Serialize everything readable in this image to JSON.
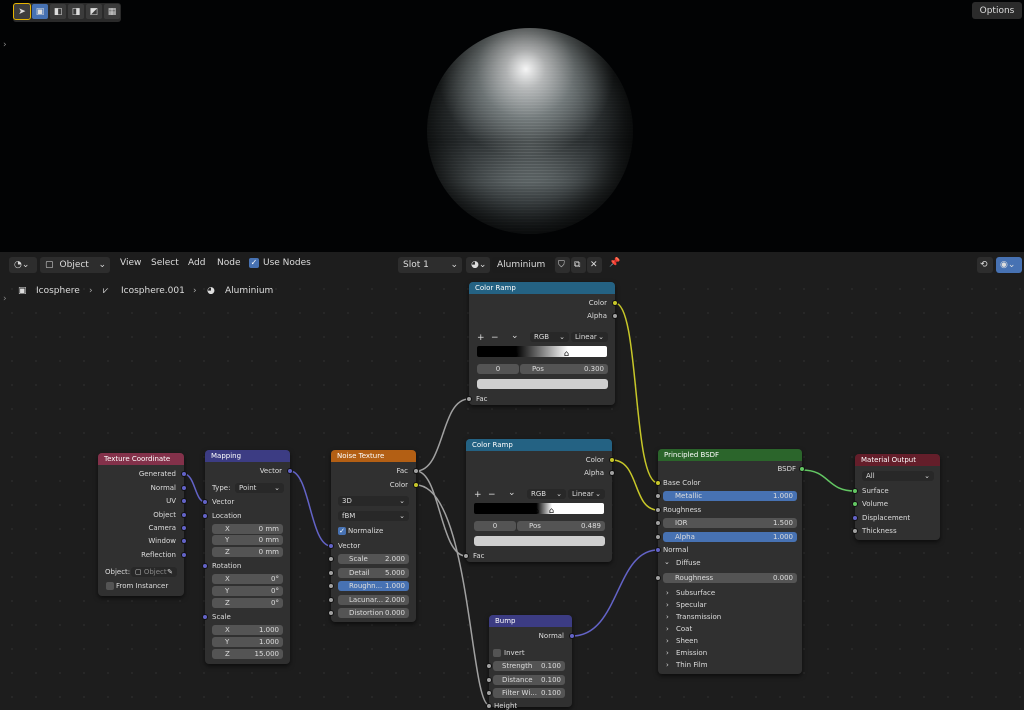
{
  "viewport": {
    "options_label": "Options"
  },
  "editor_header": {
    "object_mode": "Object",
    "menus": [
      "View",
      "Select",
      "Add",
      "Node"
    ],
    "use_nodes_label": "Use Nodes",
    "slot": "Slot 1",
    "material_name": "Aluminium"
  },
  "breadcrumb": [
    "Icosphere",
    "Icosphere.001",
    "Aluminium"
  ],
  "nodes": {
    "texcoord": {
      "title": "Texture Coordinate",
      "outputs": [
        "Generated",
        "Normal",
        "UV",
        "Object",
        "Camera",
        "Window",
        "Reflection"
      ],
      "object_label": "Object:",
      "object_placeholder": "Object",
      "from_instancer": "From Instancer"
    },
    "mapping": {
      "title": "Mapping",
      "output": "Vector",
      "type_label": "Type:",
      "type_value": "Point",
      "vector_label": "Vector",
      "location_label": "Location",
      "location": [
        {
          "k": "X",
          "v": "0 mm"
        },
        {
          "k": "Y",
          "v": "0 mm"
        },
        {
          "k": "Z",
          "v": "0 mm"
        }
      ],
      "rotation_label": "Rotation",
      "rotation": [
        {
          "k": "X",
          "v": "0°"
        },
        {
          "k": "Y",
          "v": "0°"
        },
        {
          "k": "Z",
          "v": "0°"
        }
      ],
      "scale_label": "Scale",
      "scale": [
        {
          "k": "X",
          "v": "1.000"
        },
        {
          "k": "Y",
          "v": "1.000"
        },
        {
          "k": "Z",
          "v": "15.000"
        }
      ]
    },
    "noise": {
      "title": "Noise Texture",
      "out_fac": "Fac",
      "out_color": "Color",
      "dimensions": "3D",
      "type": "fBM",
      "normalize": "Normalize",
      "vector_label": "Vector",
      "params": [
        {
          "k": "Scale",
          "v": "2.000"
        },
        {
          "k": "Detail",
          "v": "5.000"
        },
        {
          "k": "Roughn...",
          "v": "1.000"
        },
        {
          "k": "Lacunar...",
          "v": "2.000"
        },
        {
          "k": "Distortion",
          "v": "0.000"
        }
      ]
    },
    "ramp1": {
      "title": "Color Ramp",
      "out_color": "Color",
      "out_alpha": "Alpha",
      "mode": "RGB",
      "interp": "Linear",
      "index": "0",
      "pos_label": "Pos",
      "pos_value": "0.300",
      "in_fac": "Fac",
      "plus": "+",
      "minus": "−",
      "chevron": "⌄"
    },
    "ramp2": {
      "title": "Color Ramp",
      "out_color": "Color",
      "out_alpha": "Alpha",
      "mode": "RGB",
      "interp": "Linear",
      "index": "0",
      "pos_label": "Pos",
      "pos_value": "0.489",
      "in_fac": "Fac",
      "plus": "+",
      "minus": "−",
      "chevron": "⌄"
    },
    "bump": {
      "title": "Bump",
      "output": "Normal",
      "invert": "Invert",
      "params": [
        {
          "k": "Strength",
          "v": "0.100"
        },
        {
          "k": "Distance",
          "v": "0.100"
        },
        {
          "k": "Filter Wi...",
          "v": "0.100"
        }
      ],
      "height_label": "Height"
    },
    "bsdf": {
      "title": "Principled BSDF",
      "output": "BSDF",
      "base_color": "Base Color",
      "metallic": {
        "k": "Metallic",
        "v": "1.000"
      },
      "roughness_label": "Roughness",
      "ior": {
        "k": "IOR",
        "v": "1.500"
      },
      "alpha": {
        "k": "Alpha",
        "v": "1.000"
      },
      "normal": "Normal",
      "diffuse": "Diffuse",
      "diff_roughness": {
        "k": "Roughness",
        "v": "0.000"
      },
      "panels": [
        "Subsurface",
        "Specular",
        "Transmission",
        "Coat",
        "Sheen",
        "Emission",
        "Thin Film"
      ]
    },
    "output": {
      "title": "Material Output",
      "target": "All",
      "inputs": [
        "Surface",
        "Volume",
        "Displacement",
        "Thickness"
      ]
    }
  },
  "colors": {
    "texcoord_header": "#83314a",
    "vector_header": "#3c3c83",
    "texture_header": "#b35f14",
    "converter_header": "#246283",
    "shader_header": "#2b652b",
    "output_header": "#641e2a",
    "accent_blue": "#4772b3"
  }
}
